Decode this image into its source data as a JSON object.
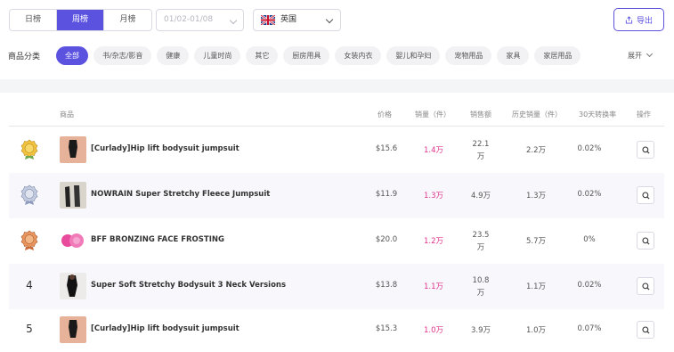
{
  "toolbar": {
    "period_tabs": [
      "日榜",
      "周榜",
      "月榜"
    ],
    "active_period": "周榜",
    "date_range": "01/02-01/08",
    "country": "英国",
    "export_label": "导出"
  },
  "categories": {
    "label": "商品分类",
    "items": [
      "全部",
      "书/杂志/影音",
      "健康",
      "儿童时尚",
      "其它",
      "厨房用具",
      "女装内衣",
      "婴儿和孕妇",
      "宠物用品",
      "家具",
      "家居用品"
    ],
    "active": "全部",
    "expand_label": "展开"
  },
  "table": {
    "headers": {
      "product": "商品",
      "price": "价格",
      "sales": "销量（件）",
      "revenue": "销售额",
      "history": "历史销量（件）",
      "conversion": "30天转换率",
      "action": "操作"
    },
    "rows": [
      {
        "rank": "1",
        "badge": "gold",
        "name": "[Curlady]Hip lift bodysuit jumpsuit",
        "price": "$15.6",
        "sales": "1.4万",
        "revenue_num": "22.1",
        "revenue_unit": "万",
        "history": "2.2万",
        "conversion": "0.02%"
      },
      {
        "rank": "2",
        "badge": "silver",
        "name": "NOWRAIN Super Stretchy Fleece Jumpsuit",
        "price": "$11.9",
        "sales": "1.3万",
        "revenue_num": "4.9万",
        "revenue_unit": "",
        "history": "1.3万",
        "conversion": "0.02%"
      },
      {
        "rank": "3",
        "badge": "bronze",
        "name": "BFF BRONZING FACE FROSTING",
        "price": "$20.0",
        "sales": "1.2万",
        "revenue_num": "23.5",
        "revenue_unit": "万",
        "history": "5.7万",
        "conversion": "0%"
      },
      {
        "rank": "4",
        "badge": "",
        "name": "Super Soft Stretchy Bodysuit 3 Neck Versions",
        "price": "$13.8",
        "sales": "1.1万",
        "revenue_num": "10.8",
        "revenue_unit": "万",
        "history": "1.1万",
        "conversion": "0.02%"
      },
      {
        "rank": "5",
        "badge": "",
        "name": "[Curlady]Hip lift bodysuit jumpsuit",
        "price": "$15.3",
        "sales": "1.0万",
        "revenue_num": "3.9万",
        "revenue_unit": "",
        "history": "1.0万",
        "conversion": "0.07%"
      }
    ]
  },
  "colors": {
    "accent": "#5b52e0",
    "sales": "#e0318b",
    "gold": "#e8b93a",
    "silver": "#9aa8c7",
    "bronze": "#e08a5a"
  }
}
